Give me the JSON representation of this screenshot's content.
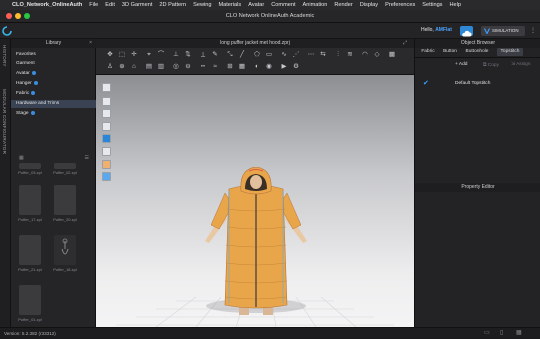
{
  "menubar": {
    "app_name": "CLO_Network_OnlineAuth",
    "items": [
      "File",
      "Edit",
      "3D Garment",
      "2D Pattern",
      "Sewing",
      "Materials",
      "Avatar",
      "Comment",
      "Animation",
      "Render",
      "Display",
      "Preferences",
      "Settings",
      "Help"
    ]
  },
  "window": {
    "title": "CLO Network OnlineAuth Academic"
  },
  "topbar": {
    "greeting": "Hello,",
    "username": "AMFlat",
    "mode_label": "SIMULATION"
  },
  "leftstrip": {
    "history": "HISTORY",
    "modular": "MODULAR CONFIGURATOR"
  },
  "library": {
    "title": "Library",
    "items": [
      {
        "label": "Favorites",
        "dot": false
      },
      {
        "label": "Garment",
        "dot": false
      },
      {
        "label": "Avatar",
        "dot": true
      },
      {
        "label": "Hanger",
        "dot": true
      },
      {
        "label": "Fabric",
        "dot": true
      },
      {
        "label": "Hardware and Trims",
        "dot": false
      },
      {
        "label": "Stage",
        "dot": true
      }
    ],
    "thumbs": [
      "Puffer_03.zpl",
      "Puffer_02.zpl",
      "Puffer_17.zpl",
      "Puffer_20.zpl",
      "Puffer_21.zpl",
      "Puffer_18.zpl",
      "Puffer_01.zpl"
    ]
  },
  "viewport": {
    "title": "long puffer jacket met hood.zprj"
  },
  "object_browser": {
    "title": "Object Browser",
    "tabs": [
      "Fabric",
      "Button",
      "Buttonhole",
      "Topstitch"
    ],
    "actions": [
      "Add",
      "Copy",
      "Assign"
    ],
    "entry": "Default Topstitch"
  },
  "property_editor": {
    "title": "Property Editor"
  },
  "status": {
    "version": "Version: 5.2.382 (r33312)"
  },
  "colors": {
    "accent": "#3a8de0",
    "garment": "#e8a54a"
  }
}
